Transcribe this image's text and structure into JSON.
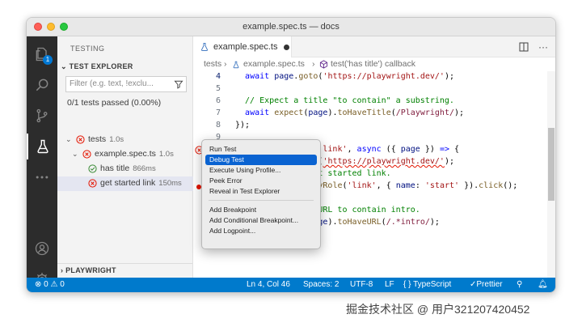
{
  "window": {
    "title": "example.spec.ts — docs"
  },
  "activity_bar": {
    "badge": "1"
  },
  "sidebar": {
    "title": "TESTING",
    "section": "TEST EXPLORER",
    "filter_placeholder": "Filter (e.g. text, !exclu...",
    "summary": "0/1 tests passed (0.00%)",
    "tree": [
      {
        "label": "tests",
        "duration": "1.0s",
        "status": "failed"
      },
      {
        "label": "example.spec.ts",
        "duration": "1.0s",
        "status": "failed"
      },
      {
        "label": "has title",
        "duration": "866ms",
        "status": "passed"
      },
      {
        "label": "get started link",
        "duration": "150ms",
        "status": "failed"
      }
    ],
    "bottom_section": "PLAYWRIGHT"
  },
  "editor": {
    "tab": {
      "label": "example.spec.ts"
    },
    "breadcrumb": [
      "tests",
      "example.spec.ts",
      "test('has title') callback"
    ]
  },
  "code_lines": [
    {
      "n": "4",
      "text": "  await page.goto('https://playwright.dev/');"
    },
    {
      "n": "5",
      "text": ""
    },
    {
      "n": "6",
      "text": "  // Expect a title \"to contain\" a substring."
    },
    {
      "n": "7",
      "text": "  await expect(page).toHaveTitle(/Playwright/);"
    },
    {
      "n": "8",
      "text": "});"
    },
    {
      "n": "9",
      "text": ""
    },
    {
      "n": "10",
      "text": "test('get started link', async ({ page }) => {"
    },
    {
      "n": "11",
      "text": "  await page.goto('https://playwright.dev/');"
    },
    {
      "n": "12",
      "text": "  // Click the get started link."
    },
    {
      "n": "13",
      "text": "  await page.getByRole('link', { name: 'start' }).click();"
    },
    {
      "n": "14",
      "text": ""
    },
    {
      "n": "15",
      "text": "  // Expects the URL to contain intro."
    },
    {
      "n": "16",
      "text": "  await expect(page).toHaveURL(/.*intro/);"
    },
    {
      "n": "17",
      "text": "});"
    },
    {
      "n": "18",
      "text": ""
    }
  ],
  "context_menu": {
    "items": [
      "Run Test",
      "Debug Test",
      "Execute Using Profile...",
      "Peek Error",
      "Reveal in Test Explorer"
    ],
    "items2": [
      "Add Breakpoint",
      "Add Conditional Breakpoint...",
      "Add Logpoint..."
    ],
    "highlighted": "Debug Test"
  },
  "status_bar": {
    "errors": "0",
    "warnings": "0",
    "position": "Ln 4, Col 46",
    "spaces": "Spaces: 2",
    "encoding": "UTF-8",
    "eol": "LF",
    "language": "TypeScript",
    "formatter": "Prettier"
  },
  "watermark": "掘金技术社区 @ 用户321207420452",
  "colors": {
    "status_bar": "#007acc",
    "activity_bar": "#2c2c2c",
    "error": "#e51400",
    "passed": "#388a34",
    "menu_highlight": "#0a63d1"
  }
}
